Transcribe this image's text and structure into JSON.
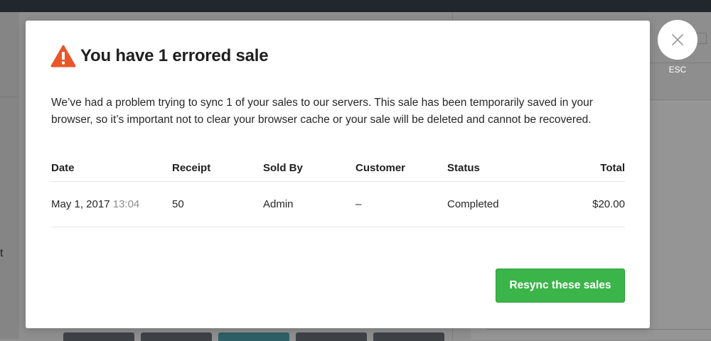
{
  "background": {
    "partial_char": "t"
  },
  "modal": {
    "title": "You have 1 errored sale",
    "warning_icon": "warning-triangle-icon",
    "warning_color": "#e8562a",
    "description": "We’ve had a problem trying to sync 1 of your sales to our servers. This sale has been temporarily saved in your browser, so it’s important not to clear your browser cache or your sale will be deleted and cannot be recovered.",
    "table": {
      "headers": {
        "date": "Date",
        "receipt": "Receipt",
        "sold_by": "Sold By",
        "customer": "Customer",
        "status": "Status",
        "total": "Total"
      },
      "rows": [
        {
          "date": "May 1, 2017",
          "time": "13:04",
          "receipt": "50",
          "sold_by": "Admin",
          "customer": "–",
          "status": "Completed",
          "total": "$20.00"
        }
      ]
    },
    "resync_label": "Resync these sales",
    "resync_color": "#3bb54a"
  },
  "close": {
    "icon": "close-icon",
    "label": "ESC"
  }
}
